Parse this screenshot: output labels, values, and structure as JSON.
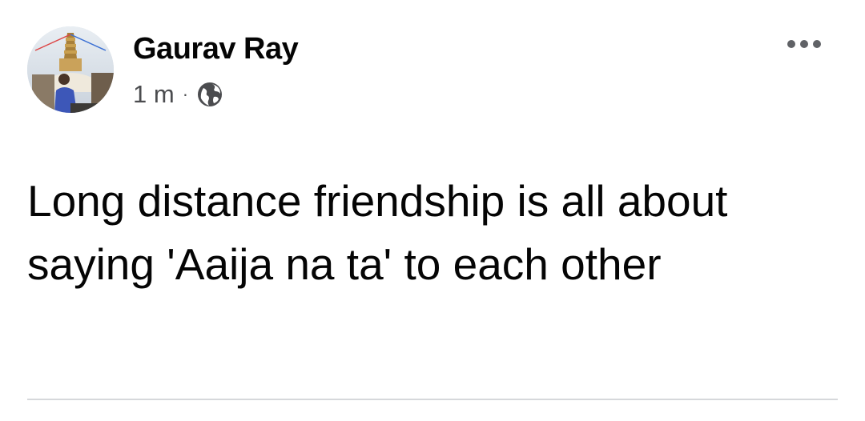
{
  "post": {
    "author_name": "Gaurav Ray",
    "timestamp": "1 m",
    "separator": "·",
    "privacy_icon": "globe-icon",
    "more_icon": "more-options-icon",
    "text": "Long distance friendship is all about saying 'Aaija na ta' to each other"
  },
  "colors": {
    "text_primary": "#050505",
    "text_secondary": "#4b4c4f",
    "divider": "#d6d8db",
    "background": "#ffffff"
  }
}
